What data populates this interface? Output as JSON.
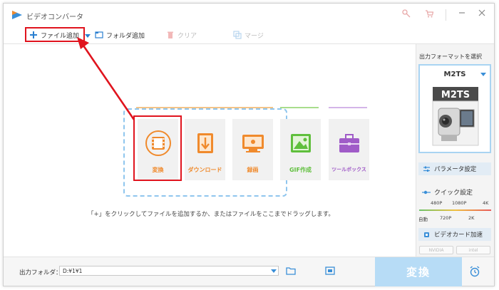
{
  "window": {
    "title": "ビデオコンバータ",
    "title_controls": [
      "key-icon",
      "cart-icon",
      "minimize-icon",
      "close-icon"
    ]
  },
  "toolbar": {
    "add_file": "ファイル追加",
    "add_folder": "フォルダ追加",
    "clear": "クリア",
    "merge": "マージ"
  },
  "cards": [
    {
      "label": "変換",
      "icon": "film-icon",
      "color": "#f08a2c"
    },
    {
      "label": "ダウンロード",
      "icon": "download-icon",
      "color": "#f08a2c"
    },
    {
      "label": "録画",
      "icon": "screen-record-icon",
      "color": "#f08a2c"
    },
    {
      "label": "GIF作成",
      "icon": "image-icon",
      "color": "#5fbf3c"
    },
    {
      "label": "ツールボックス",
      "icon": "toolbox-icon",
      "color": "#a05cc8"
    }
  ],
  "hint": "「+」をクリックしてファイルを追加するか、またはファイルをここまでドラッグします。",
  "side": {
    "title": "出力フォーマットを選択",
    "format": "M2TS",
    "format_thumb_label": "M2TS",
    "param_button": "パラメータ設定",
    "quick_label": "クイック設定",
    "quality_top": [
      "480P",
      "1080P",
      "4K"
    ],
    "quality_bottom": [
      "自動",
      "720P",
      "2K"
    ],
    "gpu_button": "ビデオカード加速",
    "gpu_badges": [
      "NVIDIA",
      "intel"
    ]
  },
  "bottom": {
    "output_label": "出力フォルダ：",
    "output_path": "D:¥1¥1",
    "convert_label": "変換"
  },
  "colors": {
    "accent": "#3a8fd8",
    "highlight": "#e0141e",
    "convert_button": "#b7dcf6"
  }
}
